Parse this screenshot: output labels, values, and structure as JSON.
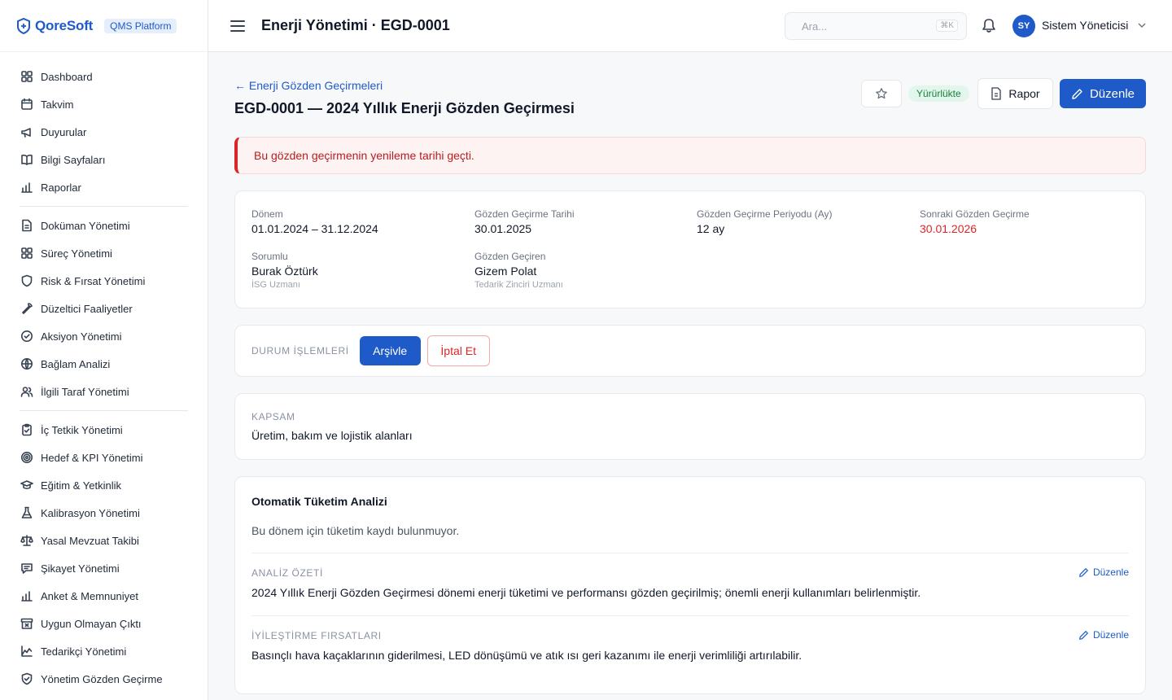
{
  "brand": {
    "name": "QoreSoft",
    "platform": "QMS Platform"
  },
  "sidebar": {
    "groups": [
      [
        {
          "label": "Dashboard",
          "icon": "dashboard-icon"
        },
        {
          "label": "Takvim",
          "icon": "calendar-icon"
        },
        {
          "label": "Duyurular",
          "icon": "megaphone-icon"
        },
        {
          "label": "Bilgi Sayfaları",
          "icon": "book-icon"
        },
        {
          "label": "Raporlar",
          "icon": "bar-chart-icon"
        }
      ],
      [
        {
          "label": "Doküman Yönetimi",
          "icon": "document-icon"
        },
        {
          "label": "Süreç Yönetimi",
          "icon": "grid-icon"
        },
        {
          "label": "Risk & Fırsat Yönetimi",
          "icon": "shield-icon"
        },
        {
          "label": "Düzeltici Faaliyetler",
          "icon": "wrench-icon"
        },
        {
          "label": "Aksiyon Yönetimi",
          "icon": "check-circle-icon"
        },
        {
          "label": "Bağlam Analizi",
          "icon": "globe-icon"
        },
        {
          "label": "İlgili Taraf Yönetimi",
          "icon": "users-icon"
        }
      ],
      [
        {
          "label": "İç Tetkik Yönetimi",
          "icon": "clipboard-check-icon"
        },
        {
          "label": "Hedef & KPI Yönetimi",
          "icon": "target-icon"
        },
        {
          "label": "Eğitim & Yetkinlik",
          "icon": "graduation-cap-icon"
        },
        {
          "label": "Kalibrasyon Yönetimi",
          "icon": "flask-icon"
        },
        {
          "label": "Yasal Mevzuat Takibi",
          "icon": "scale-icon"
        },
        {
          "label": "Şikayet Yönetimi",
          "icon": "message-icon"
        },
        {
          "label": "Anket & Memnuniyet",
          "icon": "bar-chart-icon"
        },
        {
          "label": "Uygun Olmayan Çıktı",
          "icon": "archive-x-icon"
        },
        {
          "label": "Tedarikçi Yönetimi",
          "icon": "area-chart-icon"
        },
        {
          "label": "Yönetim Gözden Geçirme",
          "icon": "shield-check-icon"
        }
      ]
    ]
  },
  "topbar": {
    "title": "Enerji Yönetimi · EGD-0001",
    "search_placeholder": "Ara...",
    "search_shortcut": "⌘K",
    "user_initials": "SY",
    "user_name": "Sistem Yöneticisi"
  },
  "header": {
    "back_label": "← Enerji Gözden Geçirmeleri",
    "title": "EGD-0001 — 2024 Yıllık Enerji Gözden Geçirmesi",
    "status": "Yürürlükte",
    "report_label": "Rapor",
    "edit_label": "Düzenle"
  },
  "alert": {
    "text": "Bu gözden geçirmenin yenileme tarihi geçti."
  },
  "details": {
    "period": {
      "label": "Dönem",
      "value": "01.01.2024 – 31.12.2024"
    },
    "review_date": {
      "label": "Gözden Geçirme Tarihi",
      "value": "30.01.2025"
    },
    "review_period": {
      "label": "Gözden Geçirme Periyodu (Ay)",
      "value": "12 ay"
    },
    "next_review": {
      "label": "Sonraki Gözden Geçirme",
      "value": "30.01.2026"
    },
    "responsible": {
      "label": "Sorumlu",
      "value": "Burak Öztürk",
      "role": "İSG Uzmanı"
    },
    "reviewer": {
      "label": "Gözden Geçiren",
      "value": "Gizem Polat",
      "role": "Tedarik Zinciri Uzmanı"
    }
  },
  "status_actions": {
    "caption": "DURUM İŞLEMLERİ",
    "archive_label": "Arşivle",
    "cancel_label": "İptal Et"
  },
  "scope": {
    "caption": "KAPSAM",
    "value": "Üretim, bakım ve lojistik alanları"
  },
  "analysis": {
    "title": "Otomatik Tüketim Analizi",
    "empty_text": "Bu dönem için tüketim kaydı bulunmuyor.",
    "summary_caption": "ANALİZ ÖZETİ",
    "summary_text": "2024 Yıllık Enerji Gözden Geçirmesi dönemi enerji tüketimi ve performansı gözden geçirilmiş; önemli enerji kullanımları belirlenmiştir.",
    "opportunities_caption": "İYİLEŞTİRME FIRSATLARI",
    "opportunities_text": "Basınçlı hava kaçaklarının giderilmesi, LED dönüşümü ve atık ısı geri kazanımı ile enerji verimliliği artırılabilir.",
    "edit_label": "Düzenle"
  },
  "colors": {
    "primary": "#1e5ac8",
    "danger": "#dc2626",
    "success": "#15803d"
  }
}
